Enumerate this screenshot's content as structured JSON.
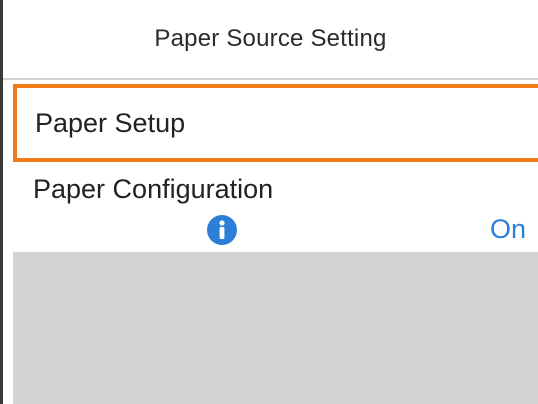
{
  "title": "Paper Source Setting",
  "menu": {
    "items": [
      {
        "label": "Paper Setup",
        "selected": true
      },
      {
        "label": "Paper Configuration",
        "icon": "info-icon",
        "value": "On"
      }
    ]
  },
  "colors": {
    "selection_border": "#f07d18",
    "value_text": "#2c7fd6",
    "info_icon": "#2c7fd6",
    "empty_area": "#d3d3d3"
  }
}
